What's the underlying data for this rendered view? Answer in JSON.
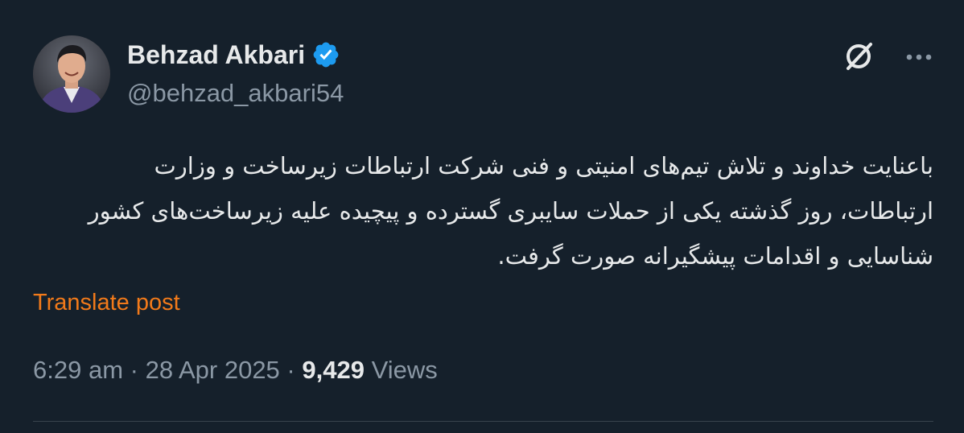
{
  "author": {
    "display_name": "Behzad Akbari",
    "handle": "@behzad_akbari54",
    "verified": true
  },
  "icons": {
    "avatar": "avatar",
    "verified": "verified-badge-icon",
    "grok": "grok-icon",
    "more": "more-options-icon"
  },
  "tweet": {
    "text": "باعنایت خداوند و تلاش تیم‌های امنیتی و فنی شرکت ارتباطات زیرساخت و وزارت ارتباطات، روز گذشته یکی از حملات سایبری گسترده و پیچیده علیه زیرساخت‌های کشور شناسایی و اقدامات پیشگیرانه صورت گرفت.",
    "translate_label": "Translate post",
    "time": "6:29 am",
    "separator": "·",
    "date": "28 Apr 2025",
    "views_count": "9,429",
    "views_label": "Views"
  },
  "colors": {
    "background": "#15202b",
    "text_primary": "#e7e9ea",
    "text_secondary": "#8b98a5",
    "translate_link": "#f27a1a",
    "verified_badge": "#1d9bf0",
    "divider": "#38444d"
  }
}
